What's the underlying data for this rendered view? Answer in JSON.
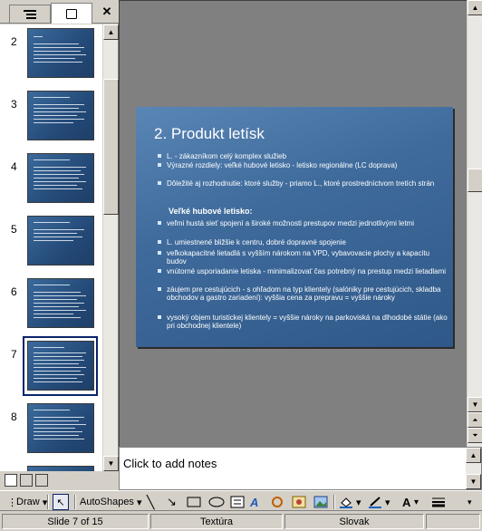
{
  "left_pane": {
    "tabs": [
      {
        "icon": "outline-icon"
      },
      {
        "icon": "slides-icon"
      }
    ],
    "close_icon": "close-icon",
    "thumbnails": [
      {
        "number": "2"
      },
      {
        "number": "3"
      },
      {
        "number": "4"
      },
      {
        "number": "5"
      },
      {
        "number": "6"
      },
      {
        "number": "7",
        "selected": true
      },
      {
        "number": "8"
      }
    ]
  },
  "slide": {
    "title": "2. Produkt letísk",
    "bullets": [
      {
        "text": "L. - zákazníkom celý komplex služieb",
        "style": "bullet"
      },
      {
        "text": "Výrazné rozdiely: veľké hubové letisko - letisko regionálne (LC doprava)",
        "style": "bullet"
      },
      {
        "text": "Dôležité aj rozhodnutie: ktoré služby - priamo L., ktoré prostredníctvom tretích strán",
        "style": "bullet"
      },
      {
        "text": "Veľké hubové letisko:",
        "style": "heading"
      },
      {
        "text": "veľmi hustá sieť spojení a široké možnosti prestupov medzi jednotlivými letmi",
        "style": "bullet"
      },
      {
        "text": "L. umiestnené bližšie k centru, dobré dopravné spojenie",
        "style": "bullet"
      },
      {
        "text": "veľkokapacitné lietadlá s vyšším nárokom na  VPD, vybavovacie plochy a kapacitu budov",
        "style": "bullet"
      },
      {
        "text": "vnútorné usporiadanie letiska - minimalizovať čas potrebný na prestup medzi lietadlami",
        "style": "bullet"
      },
      {
        "text": "záujem pre cestujúcich - s ohľadom na typ klientely (salóniky pre cestujúcich, skladba obchodov a gastro zariadení): vyššia cena za prepravu = vyššie nároky",
        "style": "bullet"
      },
      {
        "text": "vysoký objem turistickej klientely = vyššie nároky na  parkoviská na dlhodobé státie (ako pri obchodnej klientele)",
        "style": "bullet"
      }
    ]
  },
  "notes": {
    "placeholder": "Click to add notes"
  },
  "toolbar": {
    "draw_label": "Draw",
    "autoshapes_label": "AutoShapes"
  },
  "status": {
    "slide": "Slide 7 of 15",
    "design": "Textúra",
    "language": "Slovak"
  },
  "colors": {
    "slide_bg": "#3f6b9c",
    "workspace_bg": "#808080",
    "chrome": "#d4d0c8",
    "selection": "#0a246a"
  }
}
